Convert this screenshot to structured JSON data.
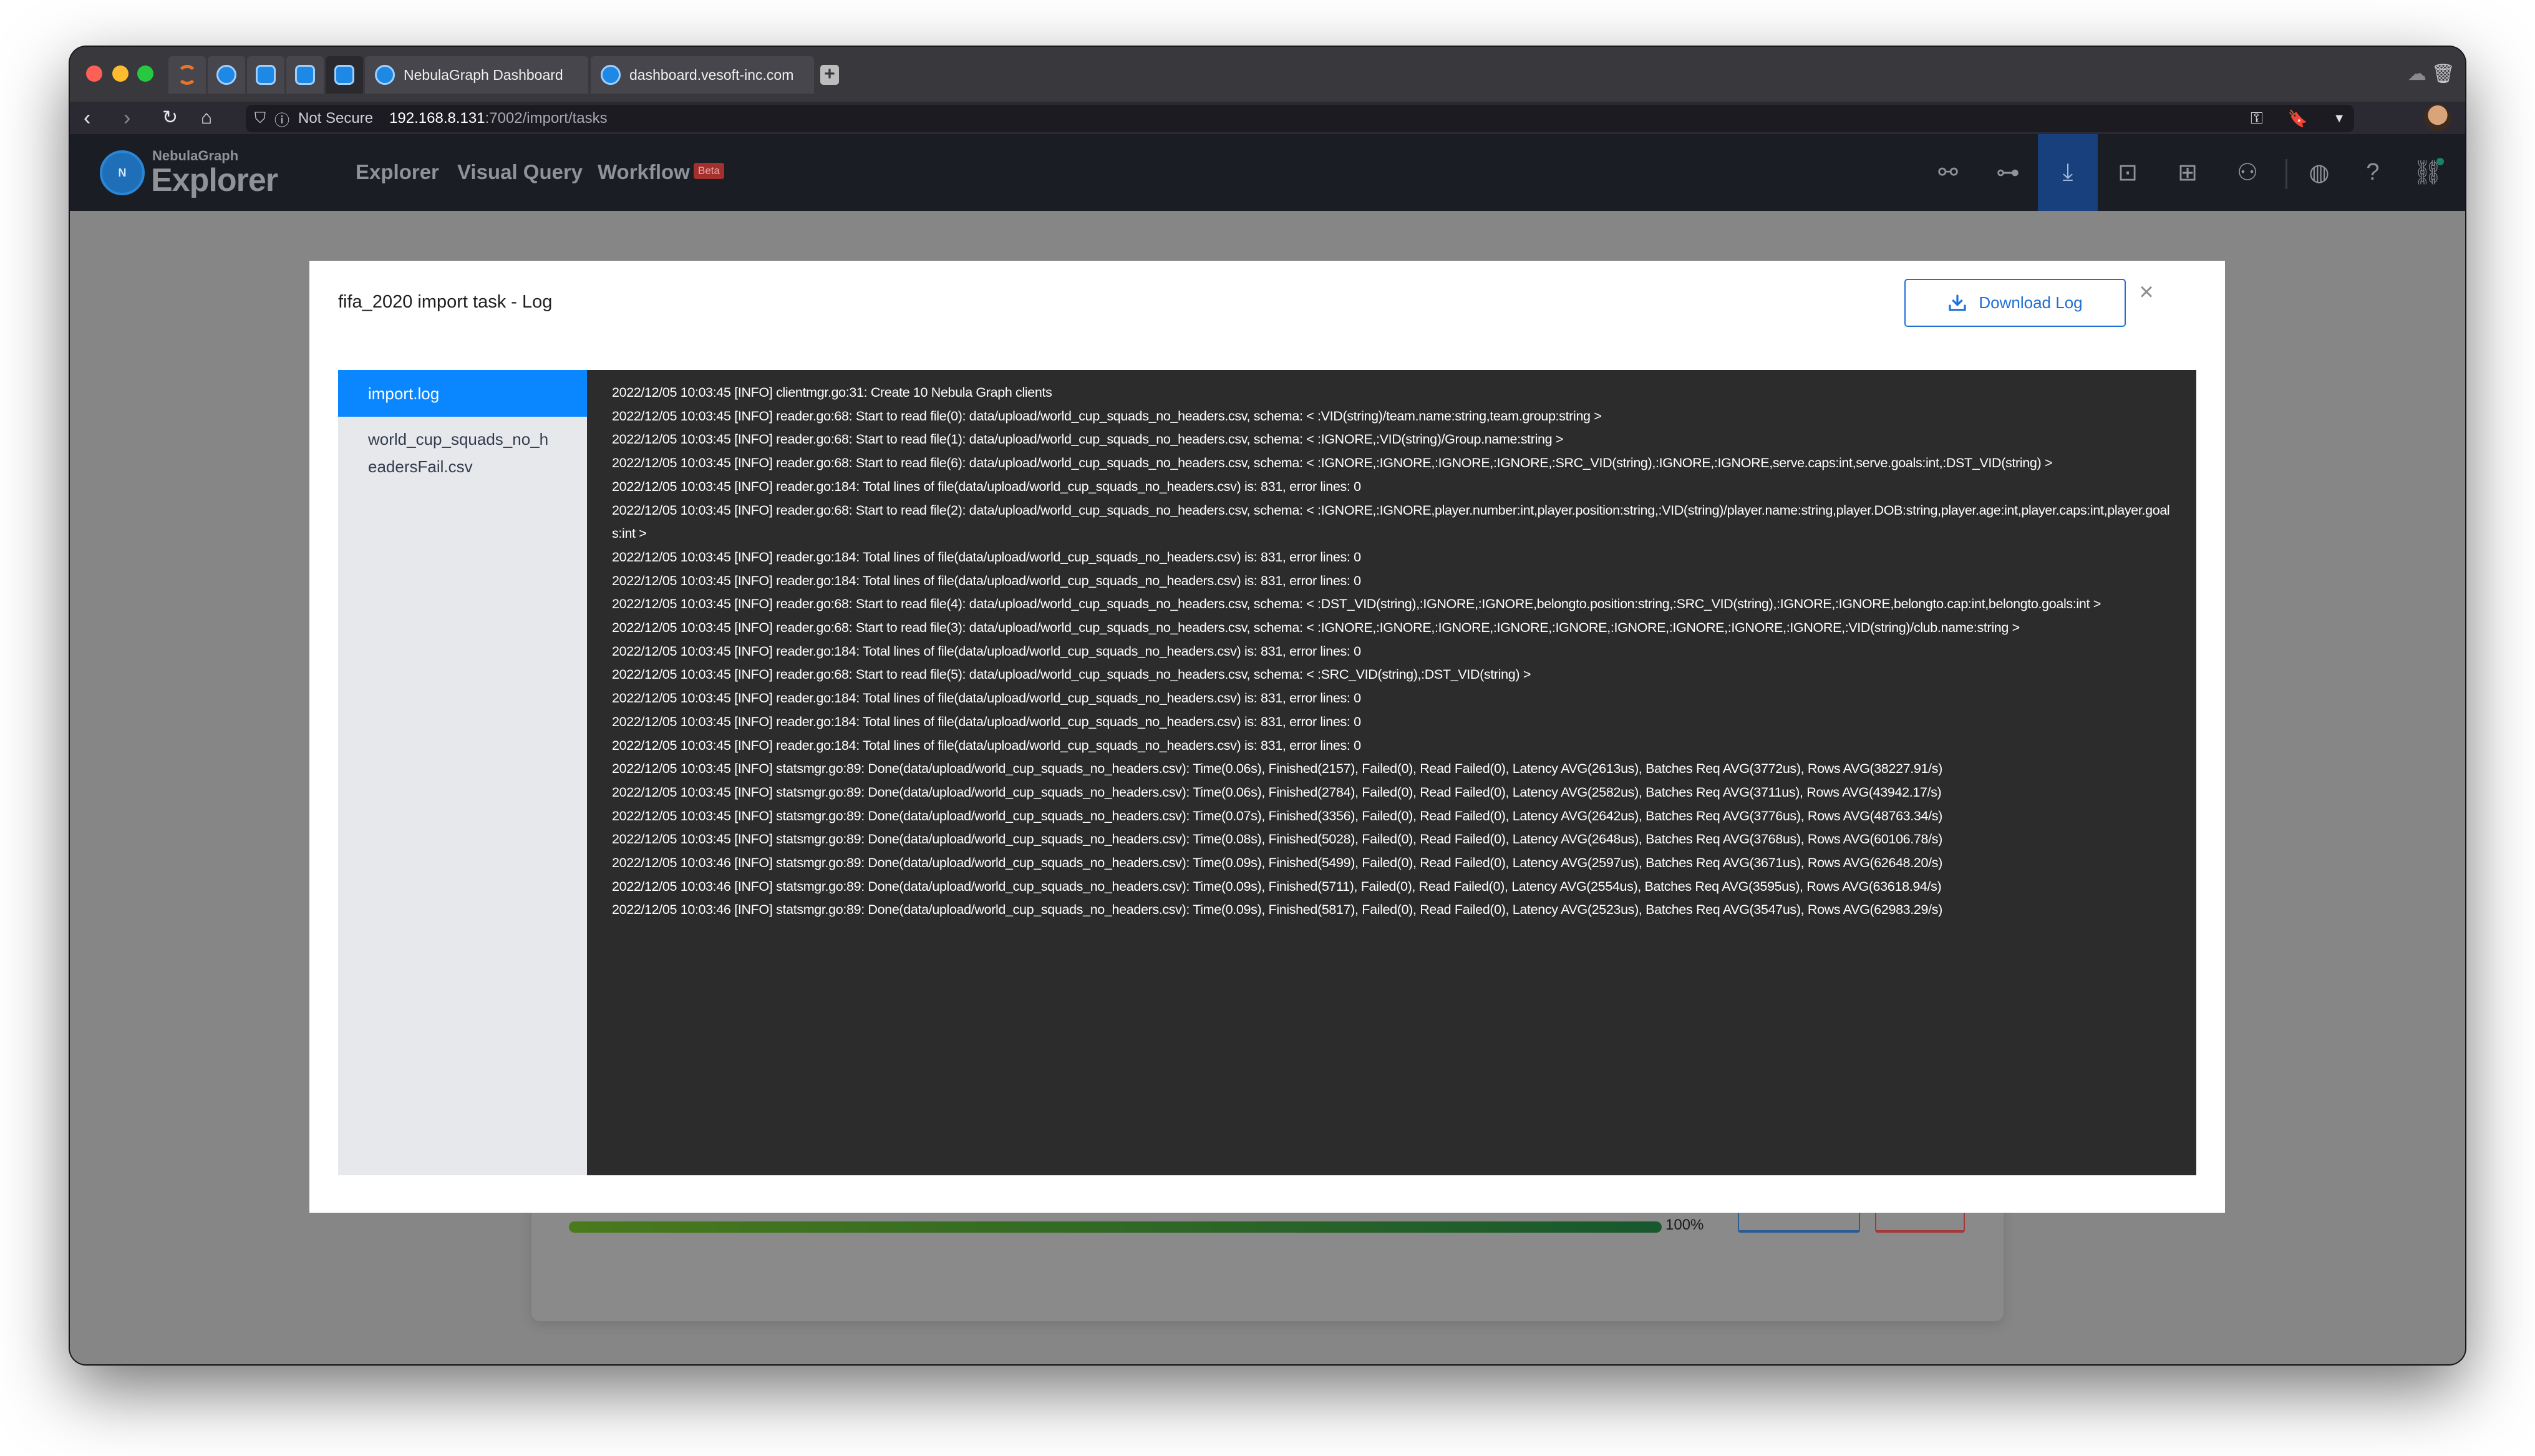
{
  "browser": {
    "tabs": [
      {
        "label": "NebulaGraph Dashboard",
        "icon": "nebula-favicon"
      },
      {
        "label": "dashboard.vesoft-inc.com",
        "icon": "nebula-favicon"
      }
    ],
    "new_tab_label": "+",
    "url": {
      "security_label": "Not Secure",
      "host": "192.168.8.131",
      "path": ":7002/import/tasks"
    }
  },
  "app": {
    "logo_small": "NebulaGraph",
    "logo_big": "Explorer",
    "logo_mark": "N",
    "nav": [
      {
        "label": "Explorer"
      },
      {
        "label": "Visual Query"
      },
      {
        "label": "Workflow"
      }
    ],
    "beta_badge": "Beta",
    "toolbar_icons": [
      {
        "name": "graph-schema-icon",
        "glyph": "⚯",
        "active": false
      },
      {
        "name": "tree-icon",
        "glyph": "⊶",
        "active": false
      },
      {
        "name": "import-icon",
        "glyph": "⤓",
        "active": true
      },
      {
        "name": "console-icon",
        "glyph": "⊡",
        "active": false
      },
      {
        "name": "layout-icon",
        "glyph": "⊞",
        "active": false
      },
      {
        "name": "users-icon",
        "glyph": "⚇",
        "active": false
      },
      {
        "name": "globe-icon",
        "glyph": "◍",
        "active": false
      },
      {
        "name": "help-icon",
        "glyph": "?",
        "active": false
      },
      {
        "name": "connection-icon",
        "glyph": "⛓",
        "active": false
      }
    ]
  },
  "background": {
    "progress_percent": 100,
    "progress_label": "100%"
  },
  "modal": {
    "title": "fifa_2020 import task - Log",
    "download_label": "Download Log",
    "close_label": "×",
    "files": [
      {
        "label": "import.log",
        "active": true
      },
      {
        "label": "world_cup_squads_no_headersFail.csv",
        "active": false
      }
    ],
    "log_lines": [
      "2022/12/05 10:03:45 [INFO] clientmgr.go:31: Create 10 Nebula Graph clients",
      "2022/12/05 10:03:45 [INFO] reader.go:68: Start to read file(0): data/upload/world_cup_squads_no_headers.csv, schema: < :VID(string)/team.name:string,team.group:string >",
      "2022/12/05 10:03:45 [INFO] reader.go:68: Start to read file(1): data/upload/world_cup_squads_no_headers.csv, schema: < :IGNORE,:VID(string)/Group.name:string >",
      "2022/12/05 10:03:45 [INFO] reader.go:68: Start to read file(6): data/upload/world_cup_squads_no_headers.csv, schema: < :IGNORE,:IGNORE,:IGNORE,:IGNORE,:SRC_VID(string),:IGNORE,:IGNORE,serve.caps:int,serve.goals:int,:DST_VID(string) >",
      "2022/12/05 10:03:45 [INFO] reader.go:184: Total lines of file(data/upload/world_cup_squads_no_headers.csv) is: 831, error lines: 0",
      "2022/12/05 10:03:45 [INFO] reader.go:68: Start to read file(2): data/upload/world_cup_squads_no_headers.csv, schema: < :IGNORE,:IGNORE,player.number:int,player.position:string,:VID(string)/player.name:string,player.DOB:string,player.age:int,player.caps:int,player.goals:int >",
      "2022/12/05 10:03:45 [INFO] reader.go:184: Total lines of file(data/upload/world_cup_squads_no_headers.csv) is: 831, error lines: 0",
      "2022/12/05 10:03:45 [INFO] reader.go:184: Total lines of file(data/upload/world_cup_squads_no_headers.csv) is: 831, error lines: 0",
      "2022/12/05 10:03:45 [INFO] reader.go:68: Start to read file(4): data/upload/world_cup_squads_no_headers.csv, schema: < :DST_VID(string),:IGNORE,:IGNORE,belongto.position:string,:SRC_VID(string),:IGNORE,:IGNORE,belongto.cap:int,belongto.goals:int >",
      "2022/12/05 10:03:45 [INFO] reader.go:68: Start to read file(3): data/upload/world_cup_squads_no_headers.csv, schema: < :IGNORE,:IGNORE,:IGNORE,:IGNORE,:IGNORE,:IGNORE,:IGNORE,:IGNORE,:IGNORE,:VID(string)/club.name:string >",
      "2022/12/05 10:03:45 [INFO] reader.go:184: Total lines of file(data/upload/world_cup_squads_no_headers.csv) is: 831, error lines: 0",
      "2022/12/05 10:03:45 [INFO] reader.go:68: Start to read file(5): data/upload/world_cup_squads_no_headers.csv, schema: < :SRC_VID(string),:DST_VID(string) >",
      "2022/12/05 10:03:45 [INFO] reader.go:184: Total lines of file(data/upload/world_cup_squads_no_headers.csv) is: 831, error lines: 0",
      "2022/12/05 10:03:45 [INFO] reader.go:184: Total lines of file(data/upload/world_cup_squads_no_headers.csv) is: 831, error lines: 0",
      "2022/12/05 10:03:45 [INFO] reader.go:184: Total lines of file(data/upload/world_cup_squads_no_headers.csv) is: 831, error lines: 0",
      "2022/12/05 10:03:45 [INFO] statsmgr.go:89: Done(data/upload/world_cup_squads_no_headers.csv): Time(0.06s), Finished(2157), Failed(0), Read Failed(0), Latency AVG(2613us), Batches Req AVG(3772us), Rows AVG(38227.91/s)",
      "2022/12/05 10:03:45 [INFO] statsmgr.go:89: Done(data/upload/world_cup_squads_no_headers.csv): Time(0.06s), Finished(2784), Failed(0), Read Failed(0), Latency AVG(2582us), Batches Req AVG(3711us), Rows AVG(43942.17/s)",
      "2022/12/05 10:03:45 [INFO] statsmgr.go:89: Done(data/upload/world_cup_squads_no_headers.csv): Time(0.07s), Finished(3356), Failed(0), Read Failed(0), Latency AVG(2642us), Batches Req AVG(3776us), Rows AVG(48763.34/s)",
      "2022/12/05 10:03:45 [INFO] statsmgr.go:89: Done(data/upload/world_cup_squads_no_headers.csv): Time(0.08s), Finished(5028), Failed(0), Read Failed(0), Latency AVG(2648us), Batches Req AVG(3768us), Rows AVG(60106.78/s)",
      "2022/12/05 10:03:46 [INFO] statsmgr.go:89: Done(data/upload/world_cup_squads_no_headers.csv): Time(0.09s), Finished(5499), Failed(0), Read Failed(0), Latency AVG(2597us), Batches Req AVG(3671us), Rows AVG(62648.20/s)",
      "2022/12/05 10:03:46 [INFO] statsmgr.go:89: Done(data/upload/world_cup_squads_no_headers.csv): Time(0.09s), Finished(5711), Failed(0), Read Failed(0), Latency AVG(2554us), Batches Req AVG(3595us), Rows AVG(63618.94/s)",
      "2022/12/05 10:03:46 [INFO] statsmgr.go:89: Done(data/upload/world_cup_squads_no_headers.csv): Time(0.09s), Finished(5817), Failed(0), Read Failed(0), Latency AVG(2523us), Batches Req AVG(3547us), Rows AVG(62983.29/s)"
    ]
  }
}
